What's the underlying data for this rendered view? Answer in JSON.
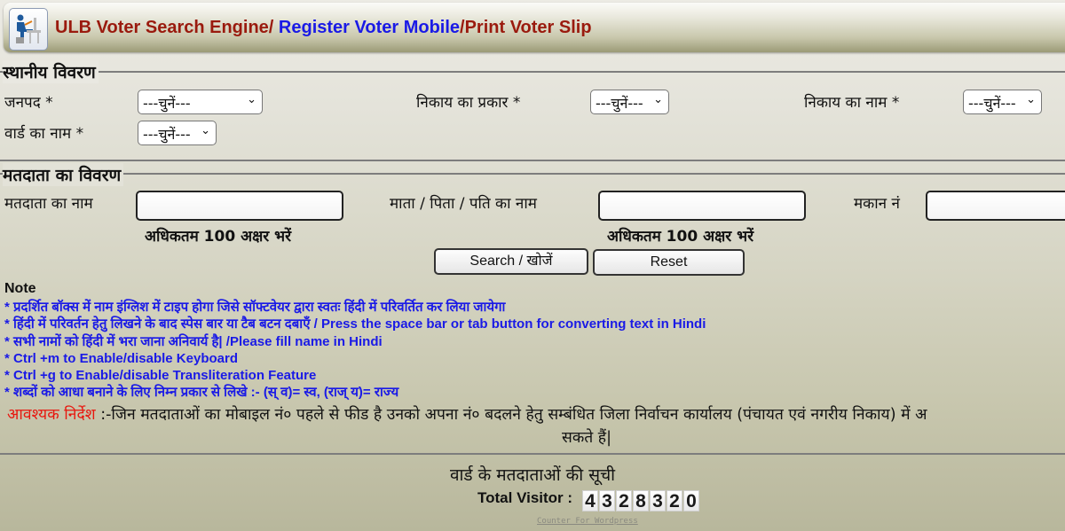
{
  "header": {
    "title_part1": "ULB Voter Search Engine/ ",
    "title_part2": "Register Voter Mobile",
    "title_part3": "/Print Voter Slip",
    "logo_icon": "computer-user-icon"
  },
  "local_details": {
    "legend": "स्थानीय विवरण",
    "district_label": "जनपद *",
    "district_value": "---चुनें---",
    "body_type_label": "निकाय का प्रकार *",
    "body_type_value": "---चुनें---",
    "body_name_label": "निकाय का नाम *",
    "body_name_value": "---चुनें---",
    "ward_label": "वार्ड का नाम *",
    "ward_value": "---चुनें---"
  },
  "voter_details": {
    "legend": "मतदाता का विवरण",
    "voter_name_label": "मतदाता का नाम",
    "voter_name_value": "",
    "voter_name_hint": "अधिकतम 100 अक्षर भरें",
    "relative_name_label": "माता / पिता / पति का नाम",
    "relative_name_value": "",
    "relative_name_hint": "अधिकतम 100 अक्षर भरें",
    "house_no_label": "मकान नं",
    "house_no_value": "",
    "search_button": "Search / खोजें",
    "reset_button": "Reset"
  },
  "notes": {
    "title": "Note",
    "items": [
      "* प्रदर्शित बॉक्स में नाम इंग्लिश में टाइप होगा जिसे सॉफ्टवेयर द्वारा स्वतः हिंदी में परिवर्तित कर लिया जायेगा",
      "* हिंदी में परिवर्तन हेतु लिखने के बाद स्पेस बार या टैब बटन दबाएँ / Press the space bar or tab button for converting text in Hindi",
      "* सभी नामों को हिंदी में भरा जाना अनिवार्य है| /Please fill name in Hindi",
      "* Ctrl +m to Enable/disable Keyboard",
      "* Ctrl +g to Enable/disable Transliteration Feature",
      "* शब्दों को आधा बनाने के लिए निम्न प्रकार से लिखे :- (स् व)= स्व, (राज् य)= राज्य"
    ]
  },
  "notice": {
    "label": "आवश्यक निर्देश",
    "text": " :-जिन मतदाताओं का मोबाइल नं० पहले से फीड है उनको अपना नं० बदलने हेतु सम्बंधित जिला निर्वाचन कार्यालय (पंचायत एवं नगरीय निकाय) में अ",
    "text_line2": "सकते हैं|"
  },
  "footer": {
    "list_title": "वार्ड के मतदाताओं की सूची",
    "visitor_label": "Total Visitor :",
    "visitor_digits": [
      "4",
      "3",
      "2",
      "8",
      "3",
      "2",
      "0"
    ],
    "counter_link": "Counter For Wordpress"
  },
  "colors": {
    "title_red": "#9a1a0e",
    "title_blue": "#1a1ae6",
    "note_blue": "#1a1ae6",
    "notice_red": "#e8160e"
  }
}
